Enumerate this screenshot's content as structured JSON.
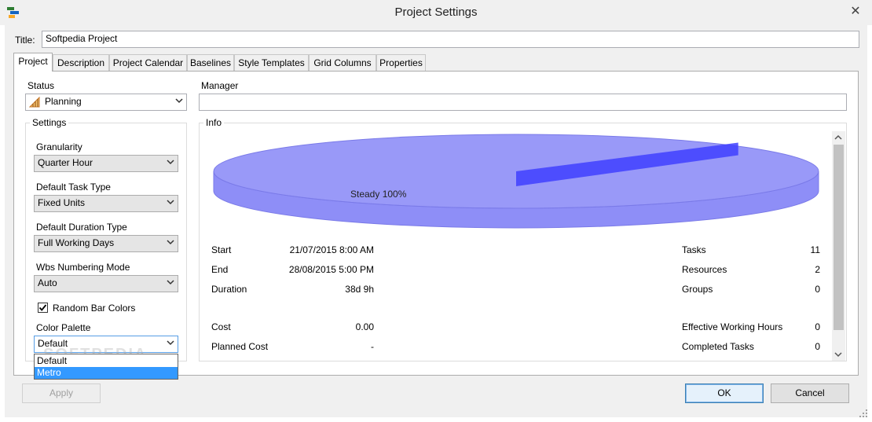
{
  "window": {
    "title": "Project Settings"
  },
  "title_field": {
    "label": "Title:",
    "value": "Softpedia Project"
  },
  "tabs": [
    {
      "label": "Project",
      "active": true
    },
    {
      "label": "Description"
    },
    {
      "label": "Project Calendar"
    },
    {
      "label": "Baselines"
    },
    {
      "label": "Style Templates"
    },
    {
      "label": "Grid Columns"
    },
    {
      "label": "Properties"
    }
  ],
  "status": {
    "label": "Status",
    "value": "Planning",
    "icon": "status-bars-icon"
  },
  "manager": {
    "label": "Manager",
    "value": ""
  },
  "settings": {
    "group_label": "Settings",
    "granularity": {
      "label": "Granularity",
      "value": "Quarter Hour"
    },
    "task_type": {
      "label": "Default Task Type",
      "value": "Fixed Units"
    },
    "duration_type": {
      "label": "Default Duration Type",
      "value": "Full Working Days"
    },
    "wbs_mode": {
      "label": "Wbs Numbering Mode",
      "value": "Auto"
    },
    "random_bar_colors": {
      "label": "Random Bar Colors",
      "checked": true
    },
    "color_palette": {
      "label": "Color Palette",
      "value": "Default",
      "options": [
        "Default",
        "Metro"
      ],
      "highlighted": "Metro"
    }
  },
  "info": {
    "group_label": "Info",
    "chart_data": {
      "type": "pie",
      "categories": [
        "Steady"
      ],
      "values": [
        100
      ],
      "labels": [
        "Steady 100%"
      ],
      "colors": [
        "#8e8ef7"
      ]
    },
    "left": [
      {
        "label": "Start",
        "value": "21/07/2015 8:00 AM"
      },
      {
        "label": "End",
        "value": "28/08/2015 5:00 PM"
      },
      {
        "label": "Duration",
        "value": "38d 9h"
      },
      {
        "label": "Cost",
        "value": "0.00"
      },
      {
        "label": "Planned Cost",
        "value": "-"
      }
    ],
    "right": [
      {
        "label": "Tasks",
        "value": "11"
      },
      {
        "label": "Resources",
        "value": "2"
      },
      {
        "label": "Groups",
        "value": "0"
      },
      {
        "label": "Effective Working Hours",
        "value": "0"
      },
      {
        "label": "Completed Tasks",
        "value": "0"
      }
    ]
  },
  "buttons": {
    "apply": "Apply",
    "ok": "OK",
    "cancel": "Cancel"
  },
  "watermark": "SOFTPEDIA",
  "colors": {
    "selection": "#3399ff",
    "pie": "#8e8ef7",
    "pie_edge": "#4040ff"
  }
}
